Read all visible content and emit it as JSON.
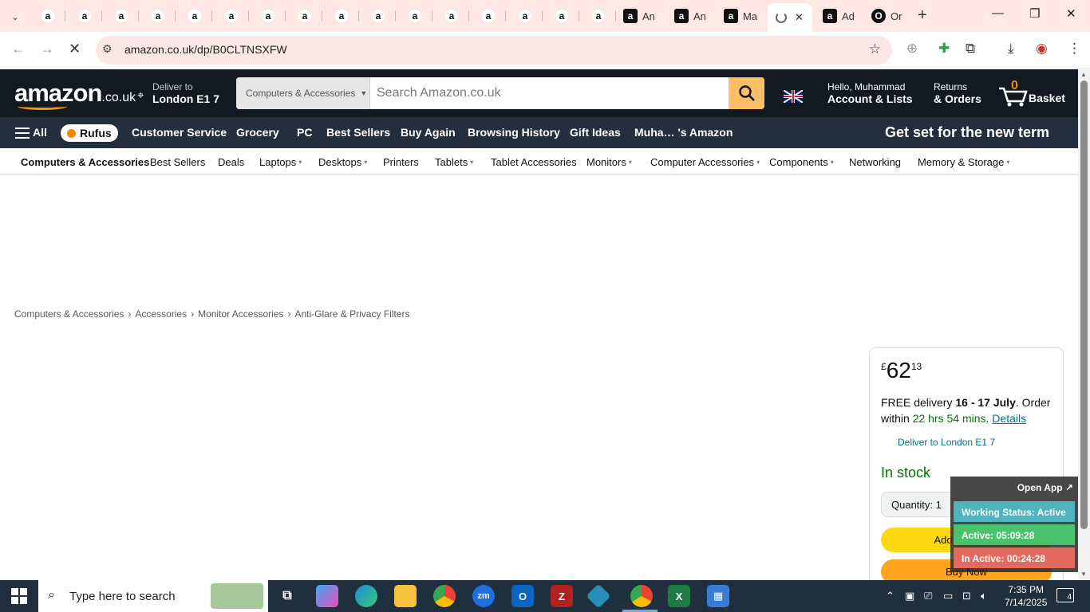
{
  "browser": {
    "tab_favicon_letter": "a",
    "tabs_text": [
      {
        "icon": "a",
        "label": "An"
      },
      {
        "icon": "a",
        "label": "An"
      },
      {
        "icon": "a",
        "label": "Ma"
      }
    ],
    "active_tab": {
      "close": "✕"
    },
    "extra_tabs": [
      {
        "icon": "a",
        "label": "Ad"
      },
      {
        "icon": "O",
        "label": "Or"
      }
    ],
    "url": "amazon.co.uk/dp/B0CLTNSXFW"
  },
  "amazon": {
    "logo_text": "amazon",
    "logo_domain": ".co.uk",
    "deliver_line1": "Deliver to",
    "deliver_line2": "London E1 7",
    "search_category": "Computers & Accessories",
    "search_placeholder": "Search Amazon.co.uk",
    "account_line1": "Hello, Muhammad",
    "account_line2": "Account & Lists",
    "returns_line1": "Returns",
    "returns_line2": "& Orders",
    "basket_count": "0",
    "basket_label": "Basket",
    "nav": {
      "all": "All",
      "rufus": "Rufus",
      "items": [
        "Customer Service",
        "Grocery",
        "PC",
        "Best Sellers",
        "Buy Again",
        "Browsing History",
        "Gift Ideas",
        "Muha… 's Amazon"
      ],
      "promo": "Get set for the new term"
    },
    "subnav": [
      "Computers & Accessories",
      "Best Sellers",
      "Deals",
      "Laptops",
      "Desktops",
      "Printers",
      "Tablets",
      "Tablet Accessories",
      "Monitors",
      "Computer Accessories",
      "Components",
      "Networking",
      "Memory & Storage"
    ],
    "breadcrumb": [
      "Computers & Accessories",
      "Accessories",
      "Monitor Accessories",
      "Anti-Glare & Privacy Filters"
    ],
    "breadcrumb_sep": "›"
  },
  "buybox": {
    "price_symbol": "£",
    "price_whole": "62",
    "price_fraction": "13",
    "delivery_prefix": "FREE delivery ",
    "delivery_dates": "16 - 17 July",
    "delivery_mid": ". Order within ",
    "delivery_countdown": "22 hrs 54 mins",
    "delivery_dot": ". ",
    "details_link": "Details",
    "deliver_to": "Deliver to London E1 7",
    "stock": "In stock",
    "quantity": "Quantity: 1",
    "add_to_basket": "Add to Basket",
    "buy_now": "Buy Now"
  },
  "tracker": {
    "open_app": "Open App ↗",
    "working_status": "Working Status: Active",
    "active": "Active: 05:09:28",
    "inactive": "In Active: 00:24:28"
  },
  "taskbar": {
    "search_placeholder": "Type here to search",
    "time": "7:35 PM",
    "date": "7/14/2025",
    "notifications": "4"
  },
  "colors": {
    "amazon_dark": "#131921",
    "amazon_nav": "#232f3e",
    "amazon_orange": "#ff9900",
    "in_stock_green": "#007600",
    "add_to_basket_yellow": "#ffd814",
    "buy_now_orange": "#ffa41c"
  }
}
